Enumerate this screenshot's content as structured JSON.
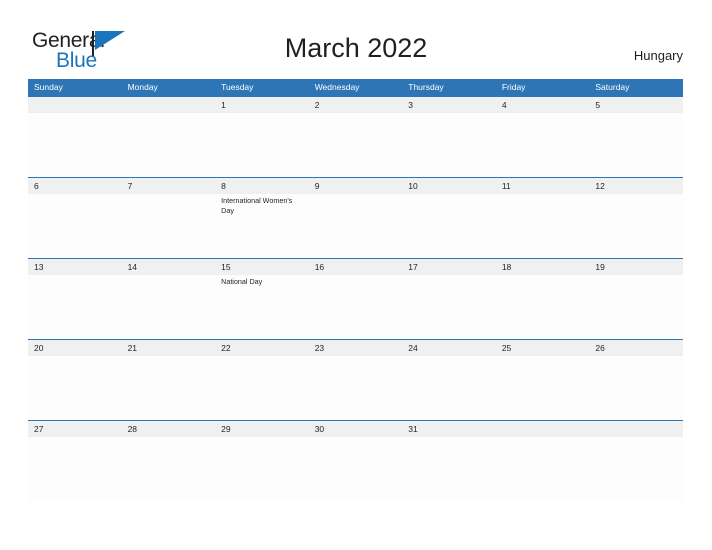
{
  "brand": {
    "name_part1": "General",
    "name_part2": "Blue",
    "flag_icon": "flag-icon",
    "color_dark": "#231f20",
    "color_blue": "#1b75bc"
  },
  "header": {
    "title": "March 2022",
    "country": "Hungary"
  },
  "calendar": {
    "header_bg": "#2e75b6",
    "daynum_bg": "#f0f0f0",
    "weekdays": [
      "Sunday",
      "Monday",
      "Tuesday",
      "Wednesday",
      "Thursday",
      "Friday",
      "Saturday"
    ],
    "weeks": [
      [
        {
          "day": "",
          "event": ""
        },
        {
          "day": "",
          "event": ""
        },
        {
          "day": "1",
          "event": ""
        },
        {
          "day": "2",
          "event": ""
        },
        {
          "day": "3",
          "event": ""
        },
        {
          "day": "4",
          "event": ""
        },
        {
          "day": "5",
          "event": ""
        }
      ],
      [
        {
          "day": "6",
          "event": ""
        },
        {
          "day": "7",
          "event": ""
        },
        {
          "day": "8",
          "event": "International Women's Day"
        },
        {
          "day": "9",
          "event": ""
        },
        {
          "day": "10",
          "event": ""
        },
        {
          "day": "11",
          "event": ""
        },
        {
          "day": "12",
          "event": ""
        }
      ],
      [
        {
          "day": "13",
          "event": ""
        },
        {
          "day": "14",
          "event": ""
        },
        {
          "day": "15",
          "event": "National Day"
        },
        {
          "day": "16",
          "event": ""
        },
        {
          "day": "17",
          "event": ""
        },
        {
          "day": "18",
          "event": ""
        },
        {
          "day": "19",
          "event": ""
        }
      ],
      [
        {
          "day": "20",
          "event": ""
        },
        {
          "day": "21",
          "event": ""
        },
        {
          "day": "22",
          "event": ""
        },
        {
          "day": "23",
          "event": ""
        },
        {
          "day": "24",
          "event": ""
        },
        {
          "day": "25",
          "event": ""
        },
        {
          "day": "26",
          "event": ""
        }
      ],
      [
        {
          "day": "27",
          "event": ""
        },
        {
          "day": "28",
          "event": ""
        },
        {
          "day": "29",
          "event": ""
        },
        {
          "day": "30",
          "event": ""
        },
        {
          "day": "31",
          "event": ""
        },
        {
          "day": "",
          "event": ""
        },
        {
          "day": "",
          "event": ""
        }
      ]
    ]
  }
}
